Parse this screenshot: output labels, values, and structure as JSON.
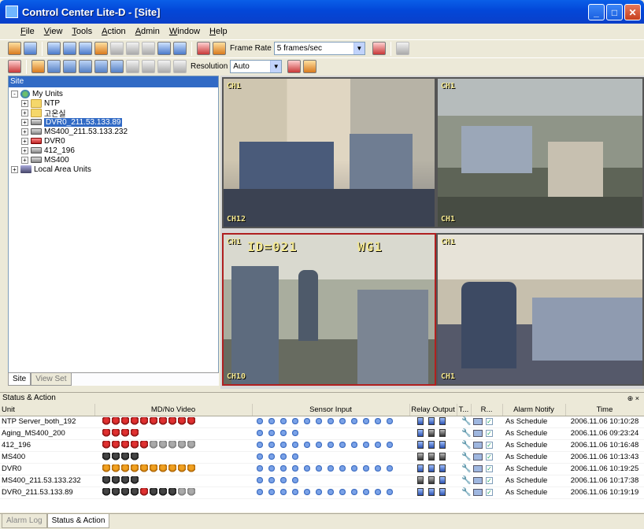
{
  "window": {
    "title": "Control Center Lite-D - [Site]"
  },
  "menu": [
    "File",
    "View",
    "Tools",
    "Action",
    "Admin",
    "Window",
    "Help"
  ],
  "toolbar1": {
    "frame_rate_label": "Frame Rate",
    "frame_rate_value": "5 frames/sec"
  },
  "toolbar2": {
    "resolution_label": "Resolution",
    "resolution_value": "Auto"
  },
  "site_panel": {
    "header": "Site",
    "tree": [
      {
        "label": "My Units",
        "icon": "globe-icon",
        "level": 0,
        "expander": "-"
      },
      {
        "label": "NTP",
        "icon": "folder-icon",
        "level": 1,
        "expander": "+"
      },
      {
        "label": "고온실",
        "icon": "folder-icon",
        "level": 1,
        "expander": "+"
      },
      {
        "label": "DVR0_211.53.133.89",
        "icon": "dvr-icon",
        "level": 1,
        "expander": "+",
        "selected": true
      },
      {
        "label": "MS400_211.53.133.232",
        "icon": "dvr-icon",
        "level": 1,
        "expander": "+"
      },
      {
        "label": "DVR0",
        "icon": "dvr-red-icon",
        "level": 1,
        "expander": "+"
      },
      {
        "label": "412_196",
        "icon": "dvr-icon",
        "level": 1,
        "expander": "+"
      },
      {
        "label": "MS400",
        "icon": "dvr-icon",
        "level": 1,
        "expander": "+"
      },
      {
        "label": "Local Area Units",
        "icon": "lan-icon",
        "level": 0,
        "expander": "+"
      }
    ],
    "tabs": [
      "Site",
      "View Set"
    ]
  },
  "cameras": [
    {
      "osd_top": "CH1",
      "osd_bottom": "CH12"
    },
    {
      "osd_top": "CH1",
      "osd_bottom": "CH1"
    },
    {
      "osd_top": "CH1",
      "osd_id": "ID=021",
      "osd_wg": "WG1",
      "osd_bottom": "CH10"
    },
    {
      "osd_top": "CH1",
      "osd_bottom": "CH1"
    }
  ],
  "status": {
    "title": "Status & Action",
    "columns": [
      "Unit",
      "MD/No Video",
      "Sensor Input",
      "Relay Output",
      "T...",
      "R...",
      "Alarm Notify",
      "Time"
    ],
    "rows": [
      {
        "unit": "NTP Server_both_192",
        "md": [
          "red",
          "red",
          "red",
          "red",
          "red",
          "red",
          "red",
          "red",
          "red",
          "red"
        ],
        "sensors": 16,
        "relays": [
          "on",
          "on",
          "on"
        ],
        "alarm": "As Schedule",
        "time": "2006.11.06 10:10:28"
      },
      {
        "unit": "Aging_MS400_200",
        "md": [
          "red",
          "red",
          "red",
          "red"
        ],
        "sensors": 4,
        "relays": [
          "on",
          "off",
          "off"
        ],
        "alarm": "As Schedule",
        "time": "2006.11.06 09:23:24"
      },
      {
        "unit": "412_196",
        "md": [
          "red",
          "red",
          "red",
          "red",
          "red",
          "gray",
          "gray",
          "gray",
          "gray",
          "gray"
        ],
        "sensors": 16,
        "relays": [
          "on",
          "on",
          "on"
        ],
        "alarm": "As Schedule",
        "time": "2006.11.06 10:16:48"
      },
      {
        "unit": "MS400",
        "md": [
          "black",
          "black",
          "black",
          "black"
        ],
        "sensors": 4,
        "relays": [
          "off",
          "off",
          "off"
        ],
        "alarm": "As Schedule",
        "time": "2006.11.06 10:13:43"
      },
      {
        "unit": "DVR0",
        "md": [
          "orange",
          "orange",
          "orange",
          "orange",
          "orange",
          "orange",
          "orange",
          "orange",
          "orange",
          "orange"
        ],
        "sensors": 16,
        "relays": [
          "on",
          "on",
          "on"
        ],
        "alarm": "As Schedule",
        "time": "2006.11.06 10:19:25"
      },
      {
        "unit": "MS400_211.53.133.232",
        "md": [
          "black",
          "black",
          "black",
          "black"
        ],
        "sensors": 4,
        "relays": [
          "off",
          "off",
          "on"
        ],
        "alarm": "As Schedule",
        "time": "2006.11.06 10:17:38"
      },
      {
        "unit": "DVR0_211.53.133.89",
        "md": [
          "black",
          "black",
          "black",
          "black",
          "red",
          "black",
          "black",
          "black",
          "gray",
          "gray"
        ],
        "sensors": 16,
        "relays": [
          "on",
          "on",
          "on"
        ],
        "alarm": "As Schedule",
        "time": "2006.11.06 10:19:19"
      }
    ]
  },
  "bottom_tabs": [
    "Alarm Log",
    "Status & Action"
  ]
}
